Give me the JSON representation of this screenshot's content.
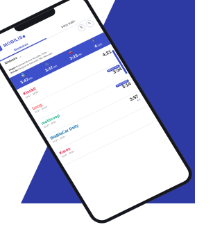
{
  "colors": {
    "brand": "#3d4fc9",
    "background_shape": "#2e3aa3",
    "phone_frame": "#16171d"
  },
  "app": {
    "logo_text": "MOBILIS",
    "menu_icon": "hamburger-icon"
  },
  "tabs": [
    {
      "label": "Itinéraires",
      "active": true
    },
    {
      "label": "Infos trafic",
      "active": false
    }
  ],
  "route": {
    "label": "Itinéraire",
    "dropdown_icon": "chevron-down-icon"
  },
  "route_icons": [
    "swap-icon",
    "options-icon"
  ],
  "origin_destination": {
    "depart_label": "Départ",
    "arrivee_label": "Arrivée",
    "depart_value": "Boulevard Bonne Nouvelle, Paris",
    "arrivee_value": "Aéroport de Beauvais-Tillé, Beauvais"
  },
  "modes": [
    {
      "icon": "train-icon",
      "time": "3:47",
      "unit": "min"
    },
    {
      "icon": "bike-icon",
      "time": "3:47",
      "unit": "min"
    },
    {
      "icon": "car-icon",
      "time": "3:23",
      "unit": "min"
    },
    {
      "icon": "walk-icon",
      "time": "4:",
      "unit": "min"
    }
  ],
  "results": [
    {
      "logo_icon": "kisskiss-icon",
      "name": "Kisskit",
      "sub": "16:57 - 18:08",
      "badge": "",
      "time": "4:21",
      "price": "",
      "dist": ""
    },
    {
      "logo_icon": "booq-icon",
      "name": "boog:",
      "sub": "15:57 - 19:12",
      "badge": "Moins cher",
      "time": "3:34",
      "price": "",
      "dist": ""
    },
    {
      "logo_icon": "mobicoop-icon",
      "name": "mobicoop",
      "sub": "15:37 - 19:01",
      "badge": "Plus rapide",
      "time": "3:14",
      "price": "",
      "dist": ""
    },
    {
      "logo_icon": "blablacar-icon",
      "name": "BlaBlaCar Daily",
      "sub": "15:37 - 19:01",
      "badge": "",
      "time": "3:57",
      "price": "8 €",
      "dist": ""
    },
    {
      "logo_icon": "karos-icon",
      "name": "Karos",
      "sub": "15:37 - 19:01",
      "badge": "",
      "time": "",
      "price": "",
      "dist": ""
    }
  ]
}
